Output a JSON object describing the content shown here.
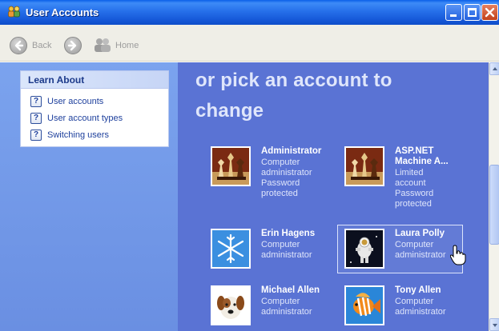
{
  "window": {
    "title": "User Accounts",
    "buttons": [
      "minimize",
      "maximize",
      "close"
    ]
  },
  "toolbar": {
    "back_label": "Back",
    "home_label": "Home"
  },
  "sidebar": {
    "learn_header": "Learn About",
    "items": [
      {
        "label": "User accounts",
        "icon": "help-icon"
      },
      {
        "label": "User account types",
        "icon": "help-icon"
      },
      {
        "label": "Switching users",
        "icon": "help-icon"
      }
    ]
  },
  "main": {
    "heading_line1": "or pick an account to",
    "heading_line2": "change",
    "accounts": [
      {
        "name": "Administrator",
        "desc": [
          "Computer",
          "administrator",
          "Password",
          "protected"
        ],
        "picture": "chess-pieces"
      },
      {
        "name": "ASP.NET",
        "name2": "Machine A...",
        "desc": [
          "Limited",
          "account",
          "Password",
          "protected"
        ],
        "picture": "chess-pieces"
      },
      {
        "name": "Erin Hagens",
        "desc": [
          "Computer",
          "administrator"
        ],
        "picture": "snowflake"
      },
      {
        "name": "Laura Polly",
        "desc": [
          "Computer",
          "administrator"
        ],
        "picture": "astronaut",
        "selected": true
      },
      {
        "name": "Michael Allen",
        "desc": [
          "Computer",
          "administrator"
        ],
        "picture": "dog"
      },
      {
        "name": "Tony Allen",
        "desc": [
          "Computer",
          "administrator"
        ],
        "picture": "fish"
      }
    ]
  },
  "colors": {
    "titlebar": "#2670ea",
    "main_bg": "#5a73d4",
    "sidebar_bg": "#7ba3ee",
    "link": "#1d3f9c"
  }
}
